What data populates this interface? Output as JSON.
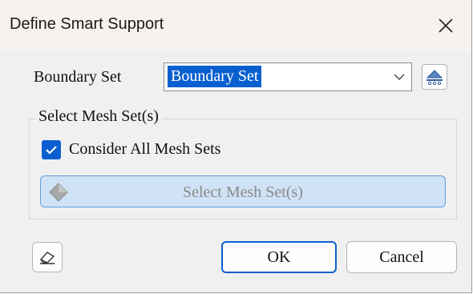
{
  "window": {
    "title": "Define Smart Support",
    "close_icon": "close-icon"
  },
  "boundary": {
    "label": "Boundary Set",
    "selected_value": "Boundary Set",
    "dropdown_icon": "chevron-down-icon",
    "select_button_icon": "boundary-set-icon"
  },
  "mesh_group": {
    "title": "Select Mesh Set(s)",
    "consider_all_label": "Consider All Mesh Sets",
    "consider_all_checked": true,
    "select_button_label": "Select Mesh Set(s)",
    "select_button_icon": "mesh-diamond-icon",
    "select_button_enabled": false
  },
  "footer": {
    "eraser_icon": "eraser-icon",
    "ok_label": "OK",
    "cancel_label": "Cancel"
  },
  "colors": {
    "accent": "#0a5fd0",
    "dialog_bg": "#f0f0f0",
    "titlebar_bg": "#f8f2ee",
    "disabled_button_bg": "#cfe2f6",
    "disabled_text": "#8a8a8a"
  }
}
